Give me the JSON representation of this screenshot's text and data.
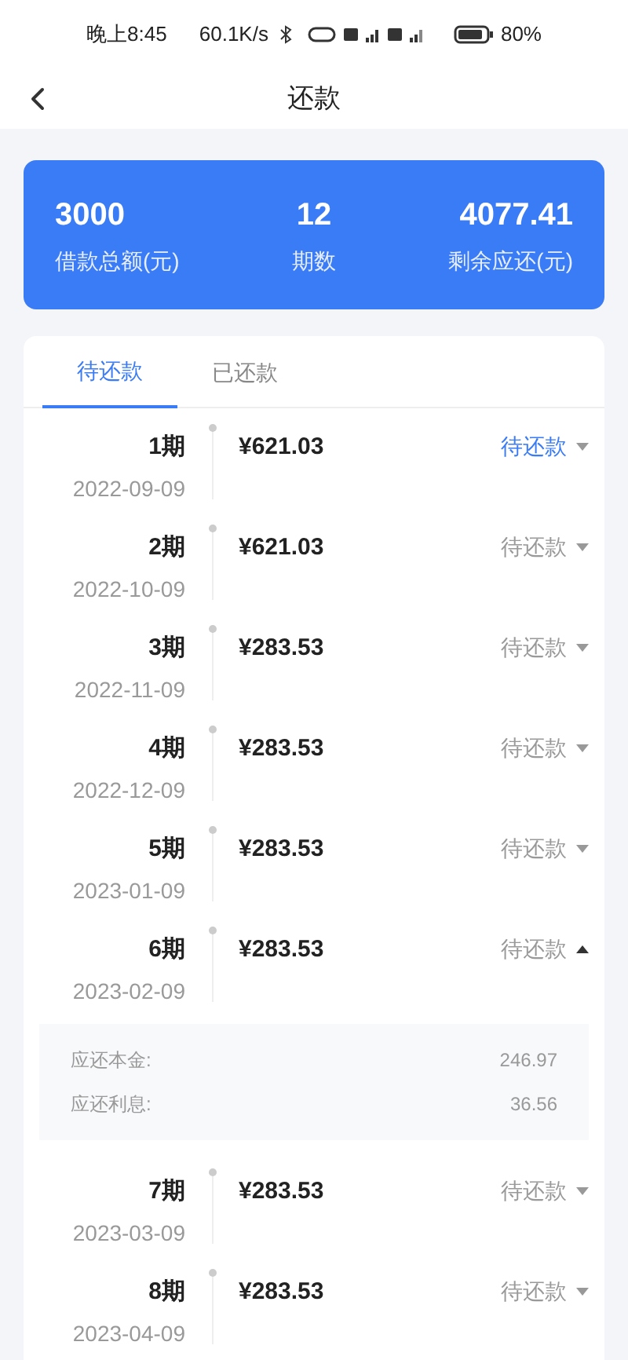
{
  "status_bar": {
    "time": "晚上8:45",
    "speed": "60.1K/s",
    "battery": "80%"
  },
  "header": {
    "title": "还款"
  },
  "summary": [
    {
      "value": "3000",
      "label": "借款总额(元)"
    },
    {
      "value": "12",
      "label": "期数"
    },
    {
      "value": "4077.41",
      "label": "剩余应还(元)"
    }
  ],
  "tabs": [
    {
      "label": "待还款",
      "selected": true
    },
    {
      "label": "已还款",
      "selected": false
    }
  ],
  "installments": [
    {
      "period": "1期",
      "date": "2022-09-09",
      "amount": "¥621.03",
      "status": "待还款",
      "current": true,
      "expanded": false
    },
    {
      "period": "2期",
      "date": "2022-10-09",
      "amount": "¥621.03",
      "status": "待还款",
      "current": false,
      "expanded": false
    },
    {
      "period": "3期",
      "date": "2022-11-09",
      "amount": "¥283.53",
      "status": "待还款",
      "current": false,
      "expanded": false
    },
    {
      "period": "4期",
      "date": "2022-12-09",
      "amount": "¥283.53",
      "status": "待还款",
      "current": false,
      "expanded": false
    },
    {
      "period": "5期",
      "date": "2023-01-09",
      "amount": "¥283.53",
      "status": "待还款",
      "current": false,
      "expanded": false
    },
    {
      "period": "6期",
      "date": "2023-02-09",
      "amount": "¥283.53",
      "status": "待还款",
      "current": false,
      "expanded": true,
      "details": [
        {
          "label": "应还本金:",
          "value": "246.97"
        },
        {
          "label": "应还利息:",
          "value": "36.56"
        }
      ]
    },
    {
      "period": "7期",
      "date": "2023-03-09",
      "amount": "¥283.53",
      "status": "待还款",
      "current": false,
      "expanded": false
    },
    {
      "period": "8期",
      "date": "2023-04-09",
      "amount": "¥283.53",
      "status": "待还款",
      "current": false,
      "expanded": false
    }
  ]
}
